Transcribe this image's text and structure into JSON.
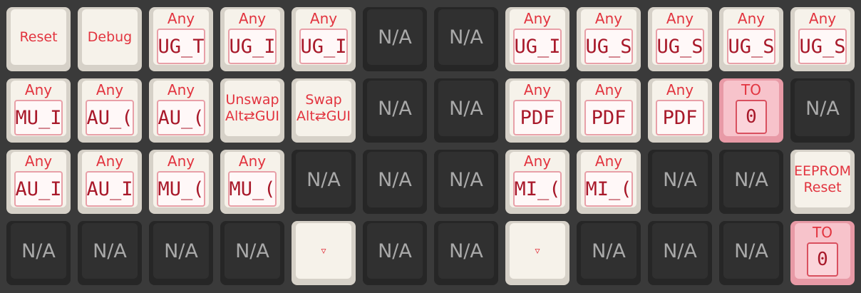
{
  "keys": [
    [
      {
        "type": "text",
        "label": "Reset"
      },
      {
        "type": "text",
        "label": "Debug"
      },
      {
        "type": "any",
        "top": "Any",
        "code": "UG_T"
      },
      {
        "type": "any",
        "top": "Any",
        "code": "UG_I"
      },
      {
        "type": "any",
        "top": "Any",
        "code": "UG_I"
      },
      {
        "type": "na",
        "label": "N/A"
      },
      {
        "type": "na",
        "label": "N/A"
      },
      {
        "type": "any",
        "top": "Any",
        "code": "UG_I"
      },
      {
        "type": "any",
        "top": "Any",
        "code": "UG_S"
      },
      {
        "type": "any",
        "top": "Any",
        "code": "UG_S"
      },
      {
        "type": "any",
        "top": "Any",
        "code": "UG_S"
      },
      {
        "type": "any",
        "top": "Any",
        "code": "UG_S"
      }
    ],
    [
      {
        "type": "any",
        "top": "Any",
        "code": "MU_I"
      },
      {
        "type": "any",
        "top": "Any",
        "code": "AU_("
      },
      {
        "type": "any",
        "top": "Any",
        "code": "AU_("
      },
      {
        "type": "text2",
        "line1": "Unswap",
        "line2": "Alt⇄GUI"
      },
      {
        "type": "text2",
        "line1": "Swap",
        "line2": "Alt⇄GUI"
      },
      {
        "type": "na",
        "label": "N/A"
      },
      {
        "type": "na",
        "label": "N/A"
      },
      {
        "type": "any",
        "top": "Any",
        "code": "PDF"
      },
      {
        "type": "any",
        "top": "Any",
        "code": "PDF"
      },
      {
        "type": "any",
        "top": "Any",
        "code": "PDF"
      },
      {
        "type": "to",
        "top": "TO",
        "code": "0"
      },
      {
        "type": "na",
        "label": "N/A"
      }
    ],
    [
      {
        "type": "any",
        "top": "Any",
        "code": "AU_I"
      },
      {
        "type": "any",
        "top": "Any",
        "code": "AU_I"
      },
      {
        "type": "any",
        "top": "Any",
        "code": "MU_("
      },
      {
        "type": "any",
        "top": "Any",
        "code": "MU_("
      },
      {
        "type": "na",
        "label": "N/A"
      },
      {
        "type": "na",
        "label": "N/A"
      },
      {
        "type": "na",
        "label": "N/A"
      },
      {
        "type": "any",
        "top": "Any",
        "code": "MI_("
      },
      {
        "type": "any",
        "top": "Any",
        "code": "MI_("
      },
      {
        "type": "na",
        "label": "N/A"
      },
      {
        "type": "na",
        "label": "N/A"
      },
      {
        "type": "text2",
        "line1": "EEPROM",
        "line2": "Reset"
      }
    ],
    [
      {
        "type": "na",
        "label": "N/A"
      },
      {
        "type": "na",
        "label": "N/A"
      },
      {
        "type": "na",
        "label": "N/A"
      },
      {
        "type": "na",
        "label": "N/A"
      },
      {
        "type": "tri",
        "label": "▿"
      },
      {
        "type": "na",
        "label": "N/A"
      },
      {
        "type": "na",
        "label": "N/A"
      },
      {
        "type": "tri",
        "label": "▿"
      },
      {
        "type": "na",
        "label": "N/A"
      },
      {
        "type": "na",
        "label": "N/A"
      },
      {
        "type": "na",
        "label": "N/A"
      },
      {
        "type": "to",
        "top": "TO",
        "code": "0"
      }
    ]
  ]
}
